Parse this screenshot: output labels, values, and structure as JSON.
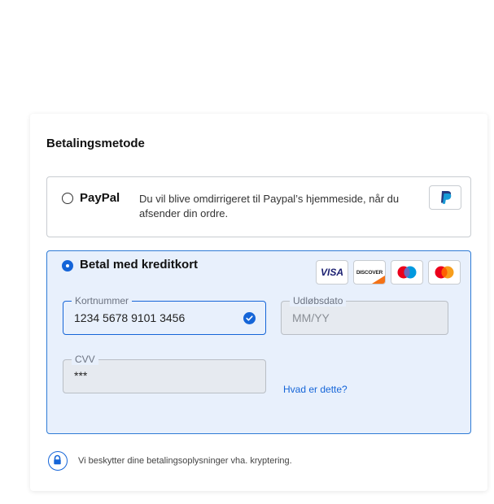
{
  "section_title": "Betalingsmetode",
  "paypal": {
    "label": "PayPal",
    "description": "Du vil blive omdirrigeret til Paypal’s hjemmeside, når du afsender din ordre.",
    "selected": false
  },
  "card": {
    "label": "Betal med kreditkort",
    "selected": true,
    "logos": [
      "VISA",
      "DISCOVER",
      "maestro",
      "mastercard"
    ],
    "card_number": {
      "label": "Kortnummer",
      "value": "1234 5678 9101 3456"
    },
    "expiry": {
      "label": "Udløbsdato",
      "placeholder": "MM/YY"
    },
    "cvv": {
      "label": "CVV",
      "value": "***"
    },
    "cvv_help_link": "Hvad er dette?"
  },
  "security_note": "Vi beskytter dine betalingsoplysninger vha. kryptering.",
  "colors": {
    "accent": "#1565d8",
    "selected_bg": "#e8f0fc"
  }
}
